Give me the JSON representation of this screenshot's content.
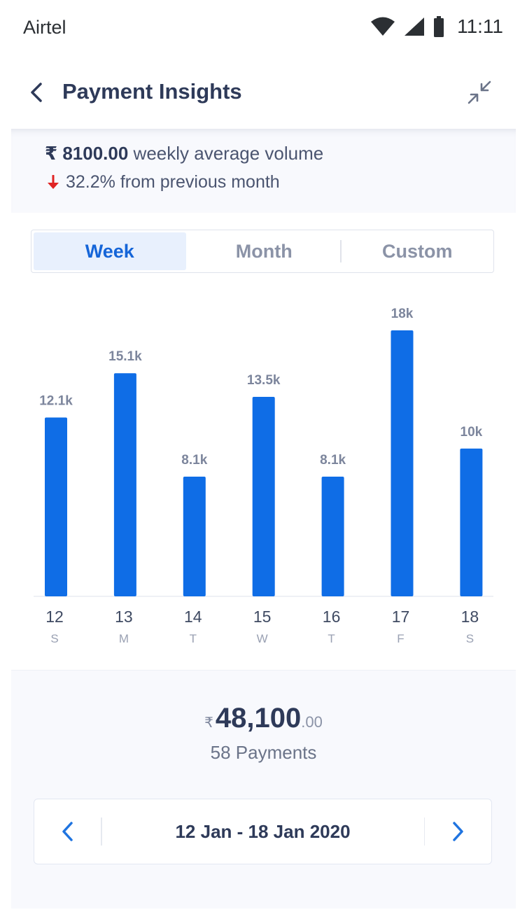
{
  "status_bar": {
    "carrier": "Airtel",
    "time": "11:11",
    "icons": [
      "wifi-icon",
      "signal-icon",
      "battery-icon"
    ]
  },
  "header": {
    "title": "Payment Insights",
    "back_icon": "chevron-left-icon",
    "collapse_icon": "collapse-icon"
  },
  "summary": {
    "amount": "₹ 8100.00",
    "amount_label": "weekly average volume",
    "change": "32.2% from previous month",
    "change_direction": "down",
    "change_color": "#e02424"
  },
  "tabs": [
    {
      "label": "Week",
      "active": true
    },
    {
      "label": "Month",
      "active": false
    },
    {
      "label": "Custom",
      "active": false
    }
  ],
  "chart_data": {
    "type": "bar",
    "categories": [
      "12",
      "13",
      "14",
      "15",
      "16",
      "17",
      "18"
    ],
    "weekdays": [
      "S",
      "M",
      "T",
      "W",
      "T",
      "F",
      "S"
    ],
    "values": [
      12100,
      15100,
      8100,
      13500,
      8100,
      18000,
      10000
    ],
    "value_labels": [
      "12.1k",
      "15.1k",
      "8.1k",
      "13.5k",
      "8.1k",
      "18k",
      "10k"
    ],
    "title": "",
    "xlabel": "",
    "ylabel": "",
    "ylim": [
      0,
      18000
    ],
    "grid": false,
    "bar_color": "#0f6de6"
  },
  "totals": {
    "currency_symbol": "₹",
    "amount_main": "48,100",
    "amount_decimal": ".00",
    "payments": "58 Payments"
  },
  "date_range": {
    "label": "12 Jan - 18 Jan 2020",
    "prev_icon": "chevron-left-icon",
    "next_icon": "chevron-right-icon",
    "accent": "#1f74e0"
  }
}
